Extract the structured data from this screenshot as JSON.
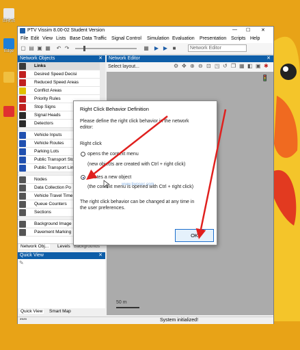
{
  "desktop": {
    "icons": [
      {
        "label": "Edge",
        "color": "#1e7fd9"
      },
      {
        "label": "",
        "color": "#f0c040"
      },
      {
        "label": "",
        "color": "#e03030"
      },
      {
        "label": "",
        "color": "#2060c0"
      }
    ]
  },
  "window": {
    "title": "PTV Vissim 8.00-02 Student Version",
    "min": "—",
    "max": "☐",
    "close": "✕"
  },
  "menubar": [
    "File",
    "Edit",
    "View",
    "Lists",
    "Base Data",
    "Traffic",
    "Signal Control",
    "Simulation",
    "Evaluation",
    "Presentation",
    "Scripts",
    "Help"
  ],
  "toolbar": {
    "network_editor_select": "Network Editor"
  },
  "network_objects": {
    "header": "Network Objects",
    "items": [
      {
        "label": "Links",
        "color": "#3a3a3a"
      },
      {
        "label": "Desired Speed Decisi",
        "color": "#c02020"
      },
      {
        "label": "Reduced Speed Areas",
        "color": "#c02020"
      },
      {
        "label": "Conflict Areas",
        "color": "#e0c000"
      },
      {
        "label": "Priority Rules",
        "color": "#c02020"
      },
      {
        "label": "Stop Signs",
        "color": "#c02020"
      },
      {
        "label": "Signal Heads",
        "color": "#2a2a2a"
      },
      {
        "label": "Detectors",
        "color": "#2a2a2a"
      },
      {
        "label": "Vehicle Inputs",
        "color": "#2050b0"
      },
      {
        "label": "Vehicle Routes",
        "color": "#2050b0"
      },
      {
        "label": "Parking Lots",
        "color": "#2050b0"
      },
      {
        "label": "Public Transport Sto",
        "color": "#2050b0"
      },
      {
        "label": "Public Transport Lin",
        "color": "#2050b0"
      },
      {
        "label": "Nodes",
        "color": "#555555"
      },
      {
        "label": "Data Collection Po",
        "color": "#555555"
      },
      {
        "label": "Vehicle Travel Time",
        "color": "#555555"
      },
      {
        "label": "Queue Counters",
        "color": "#555555"
      },
      {
        "label": "Sections",
        "color": "#555555"
      },
      {
        "label": "Background Image",
        "color": "#555555"
      },
      {
        "label": "Pavement Marking",
        "color": "#555555"
      }
    ],
    "tabs": [
      "Network Obj...",
      "Levels",
      "Backgrounds"
    ]
  },
  "quick_view": {
    "header": "Quick View",
    "tabs": [
      "Quick View",
      "Smart Map"
    ]
  },
  "network_editor": {
    "header": "Network Editor",
    "layout_select": "Select layout...",
    "scale_label": "50 m"
  },
  "status_bar": {
    "left": "****",
    "message": "System initialized!"
  },
  "dialog": {
    "title": "Right Click Behavior Definition",
    "intro_line1": "Please define the right click behavior in the network",
    "intro_line2": "editor:",
    "section_label": "Right click",
    "option1_label": "opens the context menu",
    "option1_desc": "(new objects are created with Ctrl + right click)",
    "option2_label": "creates a new object",
    "option2_desc": "(the context menu is opened with Ctrl + right click)",
    "footer_line1": "The right click behavior can be changed at any time in",
    "footer_line2": "the user preferences.",
    "ok_label": "OK",
    "selected_option": 2
  },
  "watermark": "www.tiwosec.com",
  "colors": {
    "annotation_arrow": "#e0201e",
    "desktop_bg": "#e8a317",
    "panel_header": "#0e5ea8"
  }
}
